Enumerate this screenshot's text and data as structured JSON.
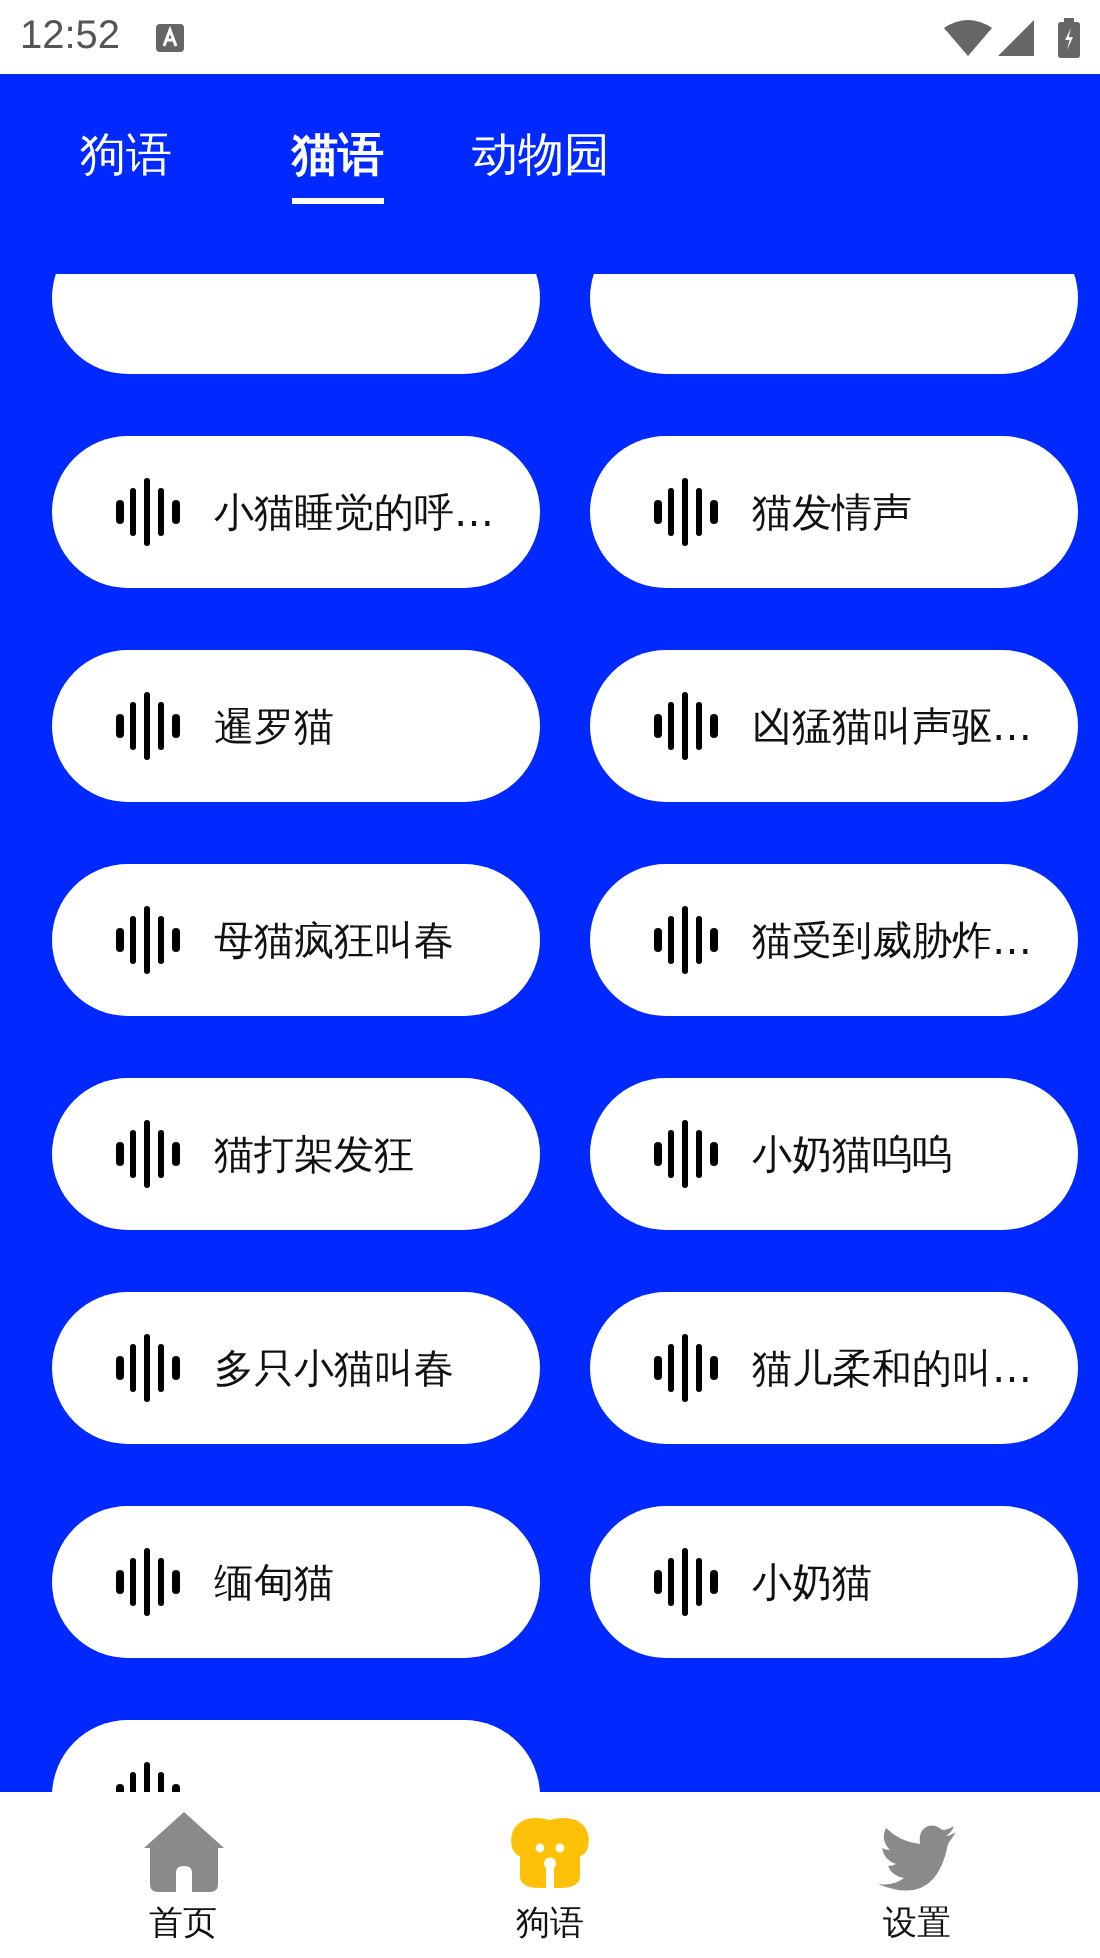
{
  "status_bar": {
    "time": "12:52"
  },
  "tabs": [
    {
      "label": "狗语",
      "selected": false
    },
    {
      "label": "猫语",
      "selected": true
    },
    {
      "label": "动物园",
      "selected": false
    }
  ],
  "sounds": [
    {
      "kind": "partial"
    },
    {
      "kind": "partial"
    },
    {
      "kind": "sound",
      "label": "小猫睡觉的呼…"
    },
    {
      "kind": "sound",
      "label": "猫发情声"
    },
    {
      "kind": "sound",
      "label": "暹罗猫"
    },
    {
      "kind": "sound",
      "label": "凶猛猫叫声驱…"
    },
    {
      "kind": "sound",
      "label": "母猫疯狂叫春"
    },
    {
      "kind": "sound",
      "label": "猫受到威胁炸…"
    },
    {
      "kind": "sound",
      "label": "猫打架发狂"
    },
    {
      "kind": "sound",
      "label": "小奶猫呜呜"
    },
    {
      "kind": "sound",
      "label": "多只小猫叫春"
    },
    {
      "kind": "sound",
      "label": "猫儿柔和的叫…"
    },
    {
      "kind": "sound",
      "label": "缅甸猫"
    },
    {
      "kind": "sound",
      "label": "小奶猫"
    },
    {
      "kind": "partial-icon"
    }
  ],
  "bottom_nav": [
    {
      "kind": "home",
      "label": "首页",
      "selected": false
    },
    {
      "kind": "dog",
      "label": "狗语",
      "selected": true
    },
    {
      "kind": "bird",
      "label": "设置",
      "selected": false
    }
  ]
}
